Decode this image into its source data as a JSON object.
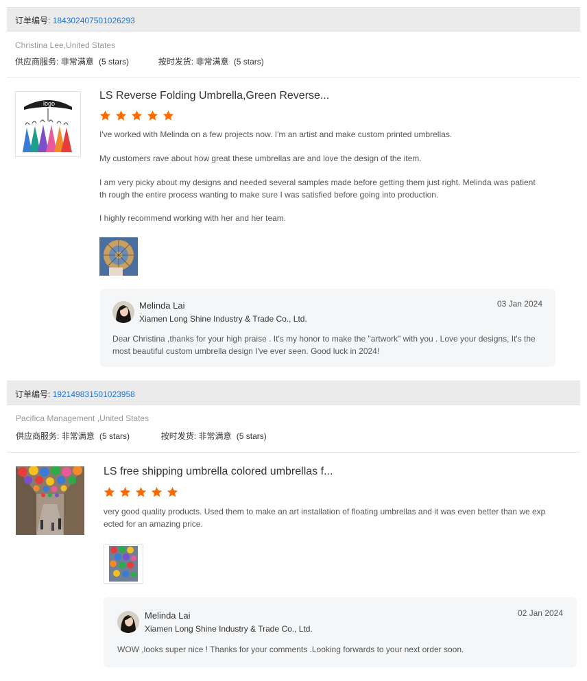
{
  "order_label": "订单编号:",
  "rating_labels": {
    "service": "供应商服务:",
    "shipping": "按时发货:"
  },
  "icons": {
    "star": "star-icon",
    "umbrella": "umbrella-icon",
    "avatar": "avatar"
  },
  "colors": {
    "star": "#ff6a00",
    "link": "#1a73d9",
    "bar": "#ebebeb",
    "reply_bg": "#f5f6f7"
  },
  "reviews": [
    {
      "order_number": "184302407501026293",
      "buyer": "Christina Lee,United States",
      "service_rating": "非常满意",
      "service_stars": "(5 stars)",
      "shipping_rating": "非常满意",
      "shipping_stars": "(5 stars)",
      "product_title": "LS Reverse Folding Umbrella,Green Reverse...",
      "product_image_label": "logo",
      "stars": 5,
      "paragraphs": [
        "I've worked with Melinda on a few projects now. I'm an artist and make custom printed umbrellas.",
        "My customers rave about how great these umbrellas are and love the design of the item.",
        "I am very picky about my designs and needed several samples made before getting them just right. Melinda was patient th rough the entire process wanting to make sure I was satisfied before going into production.",
        "I highly recommend working with her and her team."
      ],
      "reply": {
        "name": "Melinda Lai",
        "company": "Xiamen Long Shine Industry & Trade Co., Ltd.",
        "date": "03 Jan 2024",
        "text": "Dear Christina ,thanks for your  high praise . It's my honor to make the \"artwork\" with you . Love your designs, It's the most beautiful custom umbrella design I've ever seen. Good luck in 2024!"
      }
    },
    {
      "order_number": "192149831501023958",
      "buyer": "Pacifica Management ,United States",
      "service_rating": "非常满意",
      "service_stars": "(5 stars)",
      "shipping_rating": "非常满意",
      "shipping_stars": "(5 stars)",
      "product_title": "LS free shipping umbrella colored umbrellas f...",
      "stars": 5,
      "paragraphs": [
        "very good quality products. Used them to make an art installation of floating umbrellas and it was even better than we exp ected for an amazing price."
      ],
      "reply": {
        "name": "Melinda Lai",
        "company": "Xiamen Long Shine Industry & Trade Co., Ltd.",
        "date": "02 Jan 2024",
        "text": "WOW ,looks super nice ! Thanks for your comments .Looking forwards to your next order soon."
      }
    }
  ]
}
